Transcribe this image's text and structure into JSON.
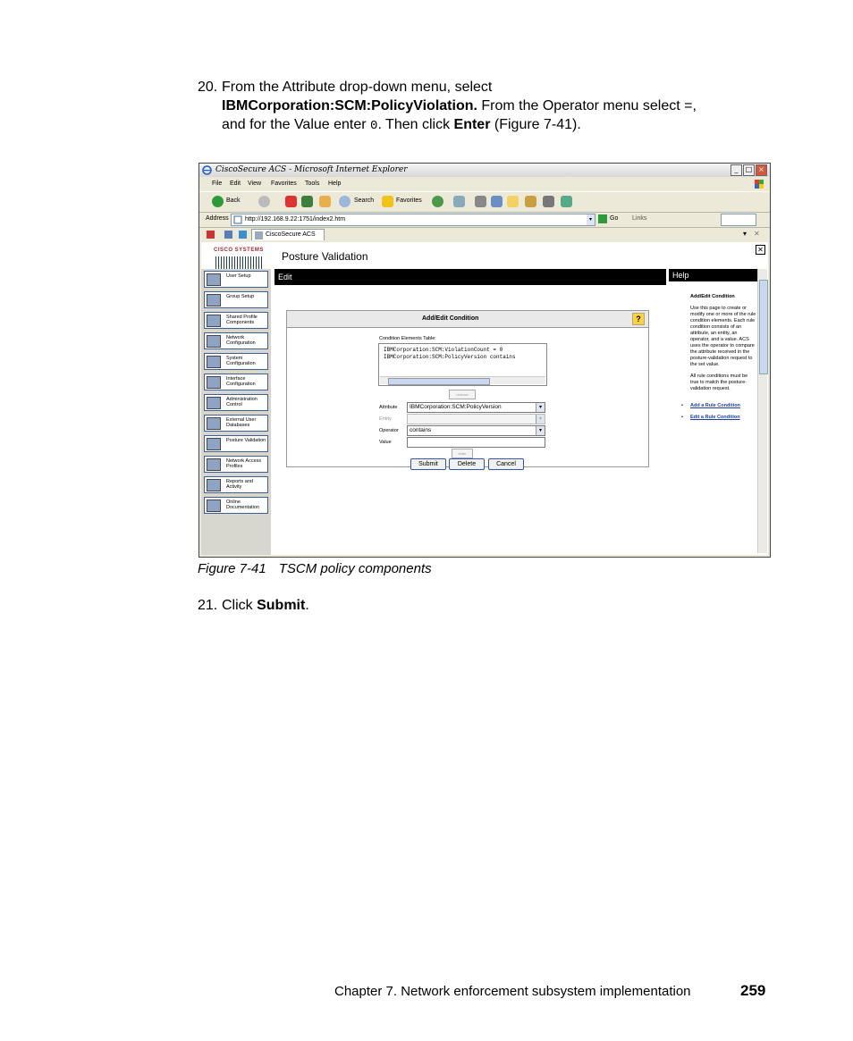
{
  "step20": {
    "number": "20.",
    "line1": "From the Attribute drop-down menu, select",
    "line2_bold": "IBMCorporation:SCM:PolicyViolation.",
    "line2_rest": " From the Operator menu select =,",
    "line3_a": "and for the Value enter ",
    "line3_mono": "0",
    "line3_b": ". Then click ",
    "line3_bold": "Enter",
    "line3_c": " (Figure 7-41)."
  },
  "screenshot": {
    "window_title": "CiscoSecure ACS - Microsoft Internet Explorer",
    "menu": [
      "File",
      "Edit",
      "View",
      "Favorites",
      "Tools",
      "Help"
    ],
    "toolbar": {
      "back": "Back",
      "search": "Search",
      "favorites": "Favorites"
    },
    "address": {
      "label": "Address",
      "url": "http://192.168.9.22:1751/index2.htm",
      "go": "Go",
      "links": "Links"
    },
    "tab_label": "CiscoSecure ACS",
    "logo_text": "CISCO SYSTEMS",
    "page_title": "Posture Validation",
    "nav": [
      {
        "label": "User Setup"
      },
      {
        "label": "Group Setup"
      },
      {
        "label": "Shared Profile Components"
      },
      {
        "label": "Network Configuration"
      },
      {
        "label": "System Configuration"
      },
      {
        "label": "Interface Configuration"
      },
      {
        "label": "Administration Control"
      },
      {
        "label": "External User Databases"
      },
      {
        "label": "Posture Validation"
      },
      {
        "label": "Network Access Profiles"
      },
      {
        "label": "Reports and Activity"
      },
      {
        "label": "Online Documentation"
      }
    ],
    "edit_header": "Edit",
    "help_header": "Help",
    "dialog": {
      "title": "Add/Edit Condition",
      "table_label": "Condition Elements Table:",
      "rows": [
        "IBMCorporation:SCM:ViolationCount = 0",
        "IBMCorporation:SCM:PolicyVersion contains"
      ],
      "remove": "remove",
      "attribute_label": "Attribute",
      "attribute_value": "IBMCorporation:SCM:PolicyVersion",
      "entity_label": "Entity",
      "operator_label": "Operator",
      "operator_value": "contains",
      "value_label": "Value",
      "enter": "enter",
      "submit": "Submit",
      "delete": "Delete",
      "cancel": "Cancel"
    },
    "help": {
      "title": "Add/Edit Condition",
      "p1": "Use this page to create or modify one or more of the rule condition elements. Each rule condition consists of an attribute, an entity, an operator, and a value. ACS uses the operator to compare the attribute received in the posture-validation request to the set value.",
      "p2": "All rule conditions must be true to match the posture-validation request.",
      "link1": "Add a Rule Condition",
      "link2": "Edit a Rule Condition"
    }
  },
  "caption": {
    "figure": "Figure 7-41",
    "text": "TSCM policy components"
  },
  "step21": {
    "number": "21.",
    "text": "Click ",
    "bold": "Submit",
    "end": "."
  },
  "footer": {
    "chapter": "Chapter 7. Network enforcement subsystem implementation",
    "page": "259"
  }
}
